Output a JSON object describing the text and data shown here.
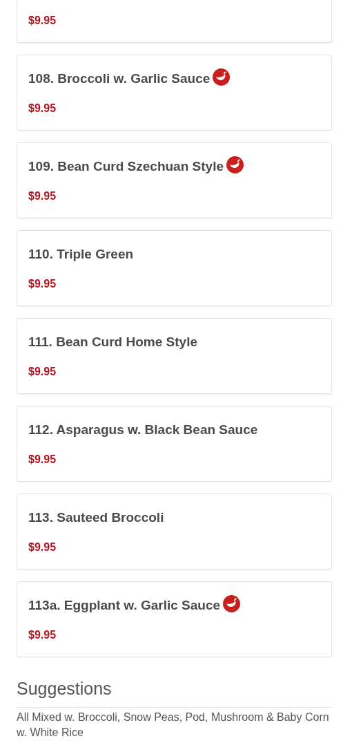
{
  "items": [
    {
      "price": "$9.95"
    },
    {
      "name": "108. Broccoli w. Garlic Sauce",
      "spicy": true,
      "price": "$9.95"
    },
    {
      "name": "109. Bean Curd Szechuan Style",
      "spicy": true,
      "price": "$9.95"
    },
    {
      "name": "110. Triple Green",
      "spicy": false,
      "price": "$9.95"
    },
    {
      "name": "111. Bean Curd Home Style",
      "spicy": false,
      "price": "$9.95"
    },
    {
      "name": "112. Asparagus w. Black Bean Sauce",
      "spicy": false,
      "price": "$9.95"
    },
    {
      "name": "113. Sauteed Broccoli",
      "spicy": false,
      "price": "$9.95"
    },
    {
      "name": "113a. Eggplant w. Garlic Sauce",
      "spicy": true,
      "price": "$9.95"
    }
  ],
  "suggestions": {
    "title": "Suggestions",
    "lines": [
      "All Mixed w. Broccoli, Snow Peas, Pod, Mushroom & Baby Corn",
      "w. White Rice"
    ]
  }
}
